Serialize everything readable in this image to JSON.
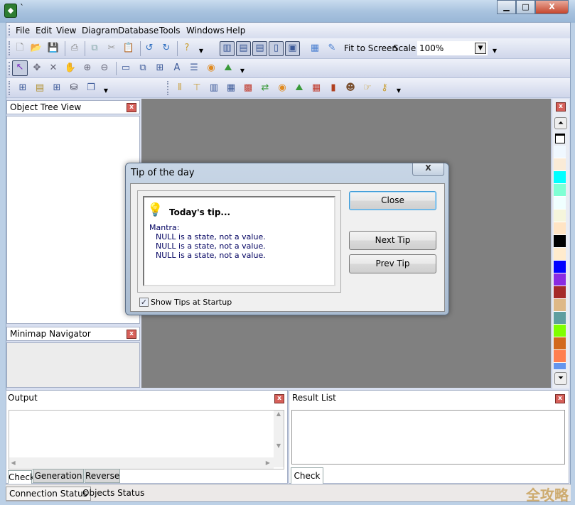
{
  "window": {
    "title": "`",
    "minimize": "▁",
    "maximize": "□",
    "close": "X"
  },
  "menu": [
    "File",
    "Edit",
    "View",
    "Diagram",
    "Database",
    "Tools",
    "Windows",
    "Help"
  ],
  "toolbar": {
    "fit_to_screen": "Fit to Screen",
    "scale_label": "Scale",
    "scale_value": "100%"
  },
  "panels": {
    "object_tree": "Object Tree View",
    "minimap": "Minimap Navigator",
    "output": "Output",
    "result_list": "Result List"
  },
  "output_tabs": [
    "Check",
    "Generation",
    "Reverse"
  ],
  "result_tabs": [
    "Check"
  ],
  "status": [
    "Connection Status",
    "Objects Status"
  ],
  "watermark": "全攻略",
  "palette": [
    "#F0F8FF",
    "#FAEBD7",
    "#00FFFF",
    "#7FFFD4",
    "#F0FFFF",
    "#F5F5DC",
    "#FFE4C4",
    "#000000",
    "#FFEBCD",
    "#0000FF",
    "#8A2BE2",
    "#A52A2A",
    "#DEB887",
    "#5F9EA0",
    "#7FFF00",
    "#D2691E",
    "#FF7F50",
    "#6495ED"
  ],
  "dialog": {
    "title": "Tip of the day",
    "close_x": "X",
    "heading": "Today's tip...",
    "body": [
      "Mantra:",
      "NULL is a state, not a value.",
      "NULL is a state, not a value.",
      "NULL is a state, not a value."
    ],
    "buttons": {
      "close": "Close",
      "next": "Next Tip",
      "prev": "Prev Tip"
    },
    "show_tips_label": "Show Tips at Startup",
    "show_tips_checked": true
  }
}
